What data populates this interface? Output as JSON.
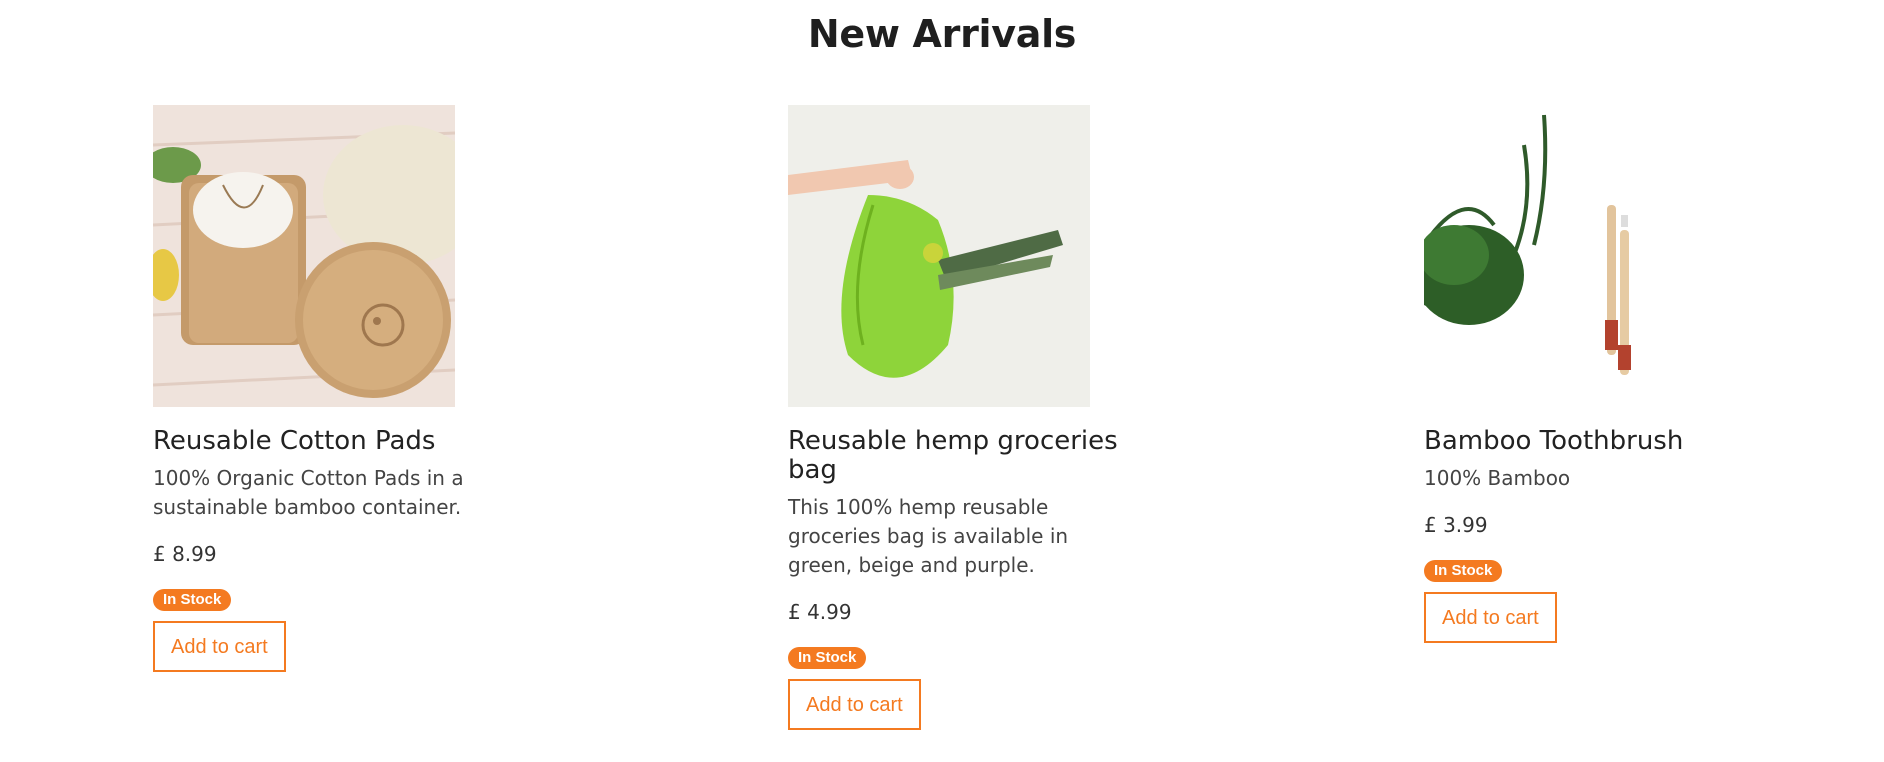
{
  "section": {
    "title": "New Arrivals"
  },
  "colors": {
    "accent": "#f47a20",
    "text": "#222222"
  },
  "products": [
    {
      "name": "Reusable Cotton Pads",
      "description": "100% Organic Cotton Pads in a sustainable bamboo container.",
      "price": "£ 8.99",
      "stock": "In Stock",
      "button": "Add to cart",
      "image": "bamboo-container-cotton-pads"
    },
    {
      "name": "Reusable hemp groceries bag",
      "description": "This 100% hemp reusable groceries bag is available in green, beige and purple.",
      "price": "£ 4.99",
      "stock": "In Stock",
      "button": "Add to cart",
      "image": "green-mesh-bag-with-leek"
    },
    {
      "name": "Bamboo Toothbrush",
      "description": "100% Bamboo",
      "price": "£ 3.99",
      "stock": "In Stock",
      "button": "Add to cart",
      "image": "bamboo-toothbrushes-with-plant"
    }
  ]
}
